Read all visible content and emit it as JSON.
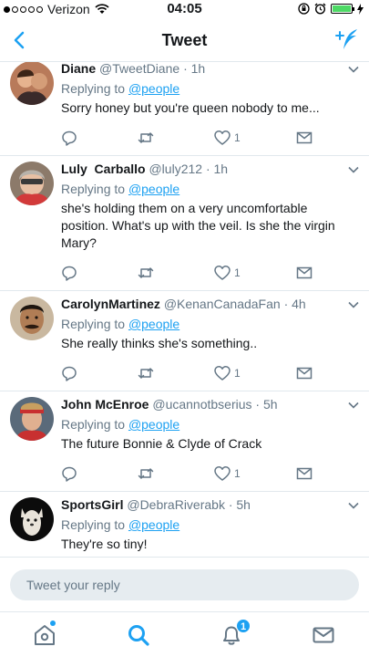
{
  "status_bar": {
    "carrier": "Verizon",
    "time": "04:05",
    "signal_dots_filled": 1,
    "signal_dots_total": 5,
    "battery_level": 1.0
  },
  "nav": {
    "title": "Tweet",
    "back_icon": "chevron-left-icon",
    "compose_icon": "compose-tweet-icon"
  },
  "tweets": [
    {
      "author": "Diane",
      "handle": "@TweetDiane",
      "time": "· 1h",
      "replying_prefix": "Replying to",
      "replying_to": "@people",
      "text": "Sorry honey but you're queen nobody to me...",
      "likes": "1"
    },
    {
      "author": "Luly  Carballo",
      "handle": "@luly212",
      "time": "· 1h",
      "replying_prefix": "Replying to",
      "replying_to": "@people",
      "text": "she's holding them on a very uncomfortable position. What's up with the veil. Is she the virgin Mary?",
      "likes": "1"
    },
    {
      "author": "CarolynMartinez",
      "handle": "@KenanCanadaFan",
      "time": "· 4h",
      "replying_prefix": "Replying to",
      "replying_to": "@people",
      "text": "She really thinks she's something..",
      "likes": "1"
    },
    {
      "author": "John McEnroe",
      "handle": "@ucannotbserius",
      "time": "· 5h",
      "replying_prefix": "Replying to",
      "replying_to": "@people",
      "text": "The future Bonnie & Clyde of Crack",
      "likes": "1"
    },
    {
      "author": "SportsGirl",
      "handle": "@DebraRiverabk",
      "time": "· 5h",
      "replying_prefix": "Replying to",
      "replying_to": "@people",
      "text": "They're so tiny!",
      "likes": ""
    }
  ],
  "reply": {
    "placeholder": "Tweet your reply"
  },
  "tabs": {
    "notification_count": "1"
  },
  "colors": {
    "accent": "#1da1f2",
    "text": "#14171a",
    "secondary": "#657786",
    "divider": "#e1e8ed"
  }
}
